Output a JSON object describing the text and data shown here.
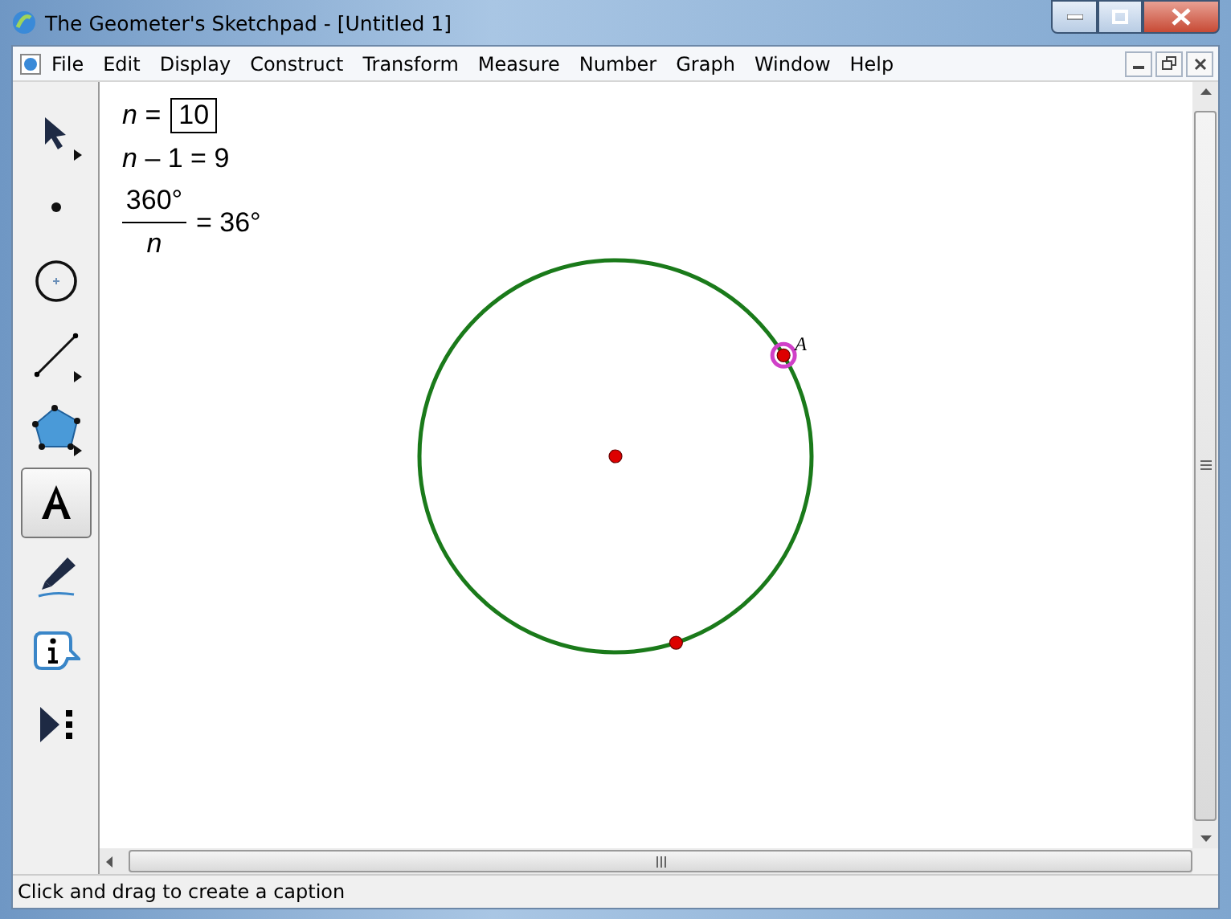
{
  "window": {
    "title": "The Geometer's Sketchpad - [Untitled 1]"
  },
  "menu": [
    "File",
    "Edit",
    "Display",
    "Construct",
    "Transform",
    "Measure",
    "Number",
    "Graph",
    "Window",
    "Help"
  ],
  "tools": [
    {
      "kind": "arrow",
      "selected": false,
      "submenu": true
    },
    {
      "kind": "point",
      "selected": false,
      "submenu": false
    },
    {
      "kind": "compass",
      "selected": false,
      "submenu": false
    },
    {
      "kind": "line",
      "selected": false,
      "submenu": true
    },
    {
      "kind": "polygon",
      "selected": false,
      "submenu": true
    },
    {
      "kind": "text",
      "selected": true,
      "submenu": false
    },
    {
      "kind": "marker",
      "selected": false,
      "submenu": false
    },
    {
      "kind": "info",
      "selected": false,
      "submenu": false
    },
    {
      "kind": "custom",
      "selected": false,
      "submenu": false
    }
  ],
  "measurements": [
    {
      "kind": "parameter",
      "label": "*n* =",
      "value": "10"
    },
    {
      "kind": "calculation",
      "text": "*n* – 1 = 9"
    },
    {
      "kind": "fraction",
      "numerator": "360°",
      "denominator": "*n*",
      "result": "= 36°"
    }
  ],
  "sketch": {
    "points": [
      {
        "kind": "center",
        "selected": false
      },
      {
        "kind": "on-circle",
        "label": "A",
        "selected": true
      },
      {
        "kind": "on-circle",
        "selected": false
      }
    ]
  },
  "status_bar": "Click and drag to create a caption"
}
